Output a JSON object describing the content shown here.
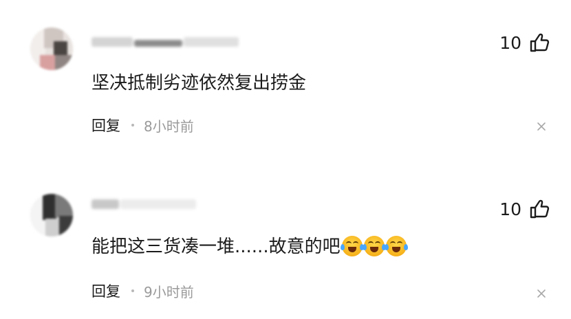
{
  "comments": [
    {
      "text": "坚决抵制劣迹依然复出捞金",
      "reply_label": "回复",
      "time": "8小时前",
      "likes": "10",
      "icons": {
        "like": "thumbs-up-icon",
        "close": "close-icon"
      }
    },
    {
      "text": "能把这三货凑一堆......故意的吧",
      "emojis": [
        "laughing-crying-emoji",
        "laughing-crying-emoji",
        "laughing-crying-emoji"
      ],
      "reply_label": "回复",
      "time": "9小时前",
      "likes": "10",
      "icons": {
        "like": "thumbs-up-icon",
        "close": "close-icon"
      }
    }
  ]
}
